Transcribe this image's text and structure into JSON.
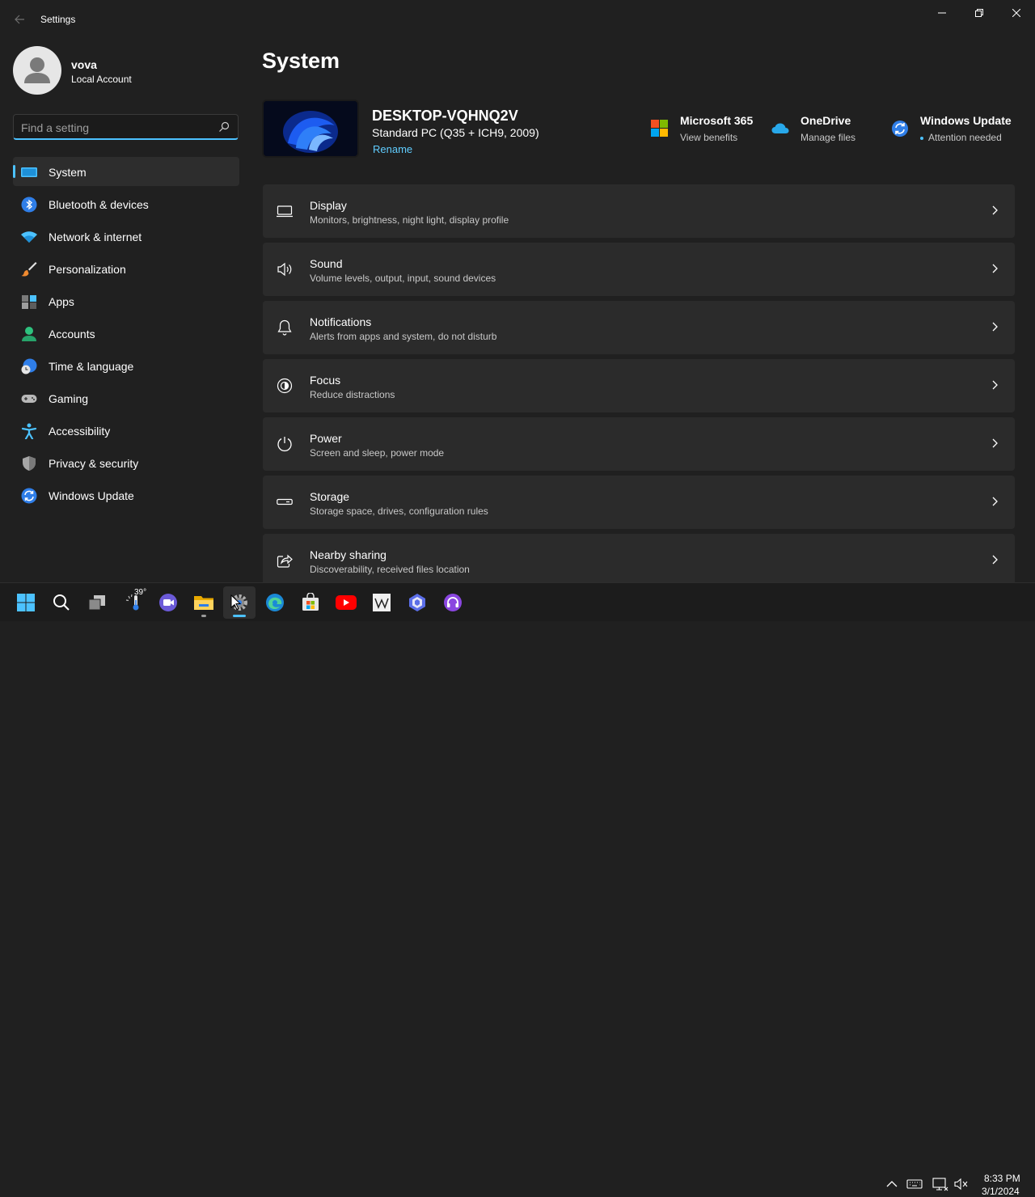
{
  "window": {
    "title": "Settings"
  },
  "user": {
    "name": "vova",
    "account_type": "Local Account"
  },
  "search": {
    "placeholder": "Find a setting",
    "value": ""
  },
  "sidebar": {
    "items": [
      {
        "label": "System",
        "icon": "monitor-icon",
        "active": true
      },
      {
        "label": "Bluetooth & devices",
        "icon": "bluetooth-icon"
      },
      {
        "label": "Network & internet",
        "icon": "wifi-icon"
      },
      {
        "label": "Personalization",
        "icon": "brush-icon"
      },
      {
        "label": "Apps",
        "icon": "apps-icon"
      },
      {
        "label": "Accounts",
        "icon": "person-icon"
      },
      {
        "label": "Time & language",
        "icon": "globe-clock-icon"
      },
      {
        "label": "Gaming",
        "icon": "gamepad-icon"
      },
      {
        "label": "Accessibility",
        "icon": "accessibility-icon"
      },
      {
        "label": "Privacy & security",
        "icon": "shield-icon"
      },
      {
        "label": "Windows Update",
        "icon": "update-icon"
      }
    ]
  },
  "main": {
    "title": "System",
    "device": {
      "name": "DESKTOP-VQHNQ2V",
      "model": "Standard PC (Q35 + ICH9, 2009)",
      "rename_label": "Rename"
    },
    "quick_links": [
      {
        "title": "Microsoft 365",
        "subtitle": "View benefits",
        "icon": "microsoft-logo-icon"
      },
      {
        "title": "OneDrive",
        "subtitle": "Manage files",
        "icon": "onedrive-icon"
      },
      {
        "title": "Windows Update",
        "subtitle": "Attention needed",
        "icon": "windows-update-icon"
      }
    ],
    "cards": [
      {
        "title": "Display",
        "subtitle": "Monitors, brightness, night light, display profile",
        "icon": "display-icon"
      },
      {
        "title": "Sound",
        "subtitle": "Volume levels, output, input, sound devices",
        "icon": "speaker-icon"
      },
      {
        "title": "Notifications",
        "subtitle": "Alerts from apps and system, do not disturb",
        "icon": "bell-icon"
      },
      {
        "title": "Focus",
        "subtitle": "Reduce distractions",
        "icon": "focus-icon"
      },
      {
        "title": "Power",
        "subtitle": "Screen and sleep, power mode",
        "icon": "power-icon"
      },
      {
        "title": "Storage",
        "subtitle": "Storage space, drives, configuration rules",
        "icon": "storage-icon"
      },
      {
        "title": "Nearby sharing",
        "subtitle": "Discoverability, received files location",
        "icon": "share-icon"
      }
    ]
  },
  "taskbar": {
    "weather_temp": "39°",
    "clock_time": "8:33 PM",
    "clock_date": "3/1/2024",
    "apps": [
      "start-icon",
      "search-icon",
      "task-view-icon",
      "weather-icon",
      "teams-icon",
      "file-explorer-icon",
      "settings-icon",
      "edge-icon",
      "store-icon",
      "youtube-icon",
      "wikipedia-icon",
      "copilot-icon",
      "headphones-app-icon"
    ]
  },
  "colors": {
    "accent": "#4cc2ff",
    "background": "#202020",
    "card": "#2b2b2b",
    "link": "#60cdff"
  }
}
